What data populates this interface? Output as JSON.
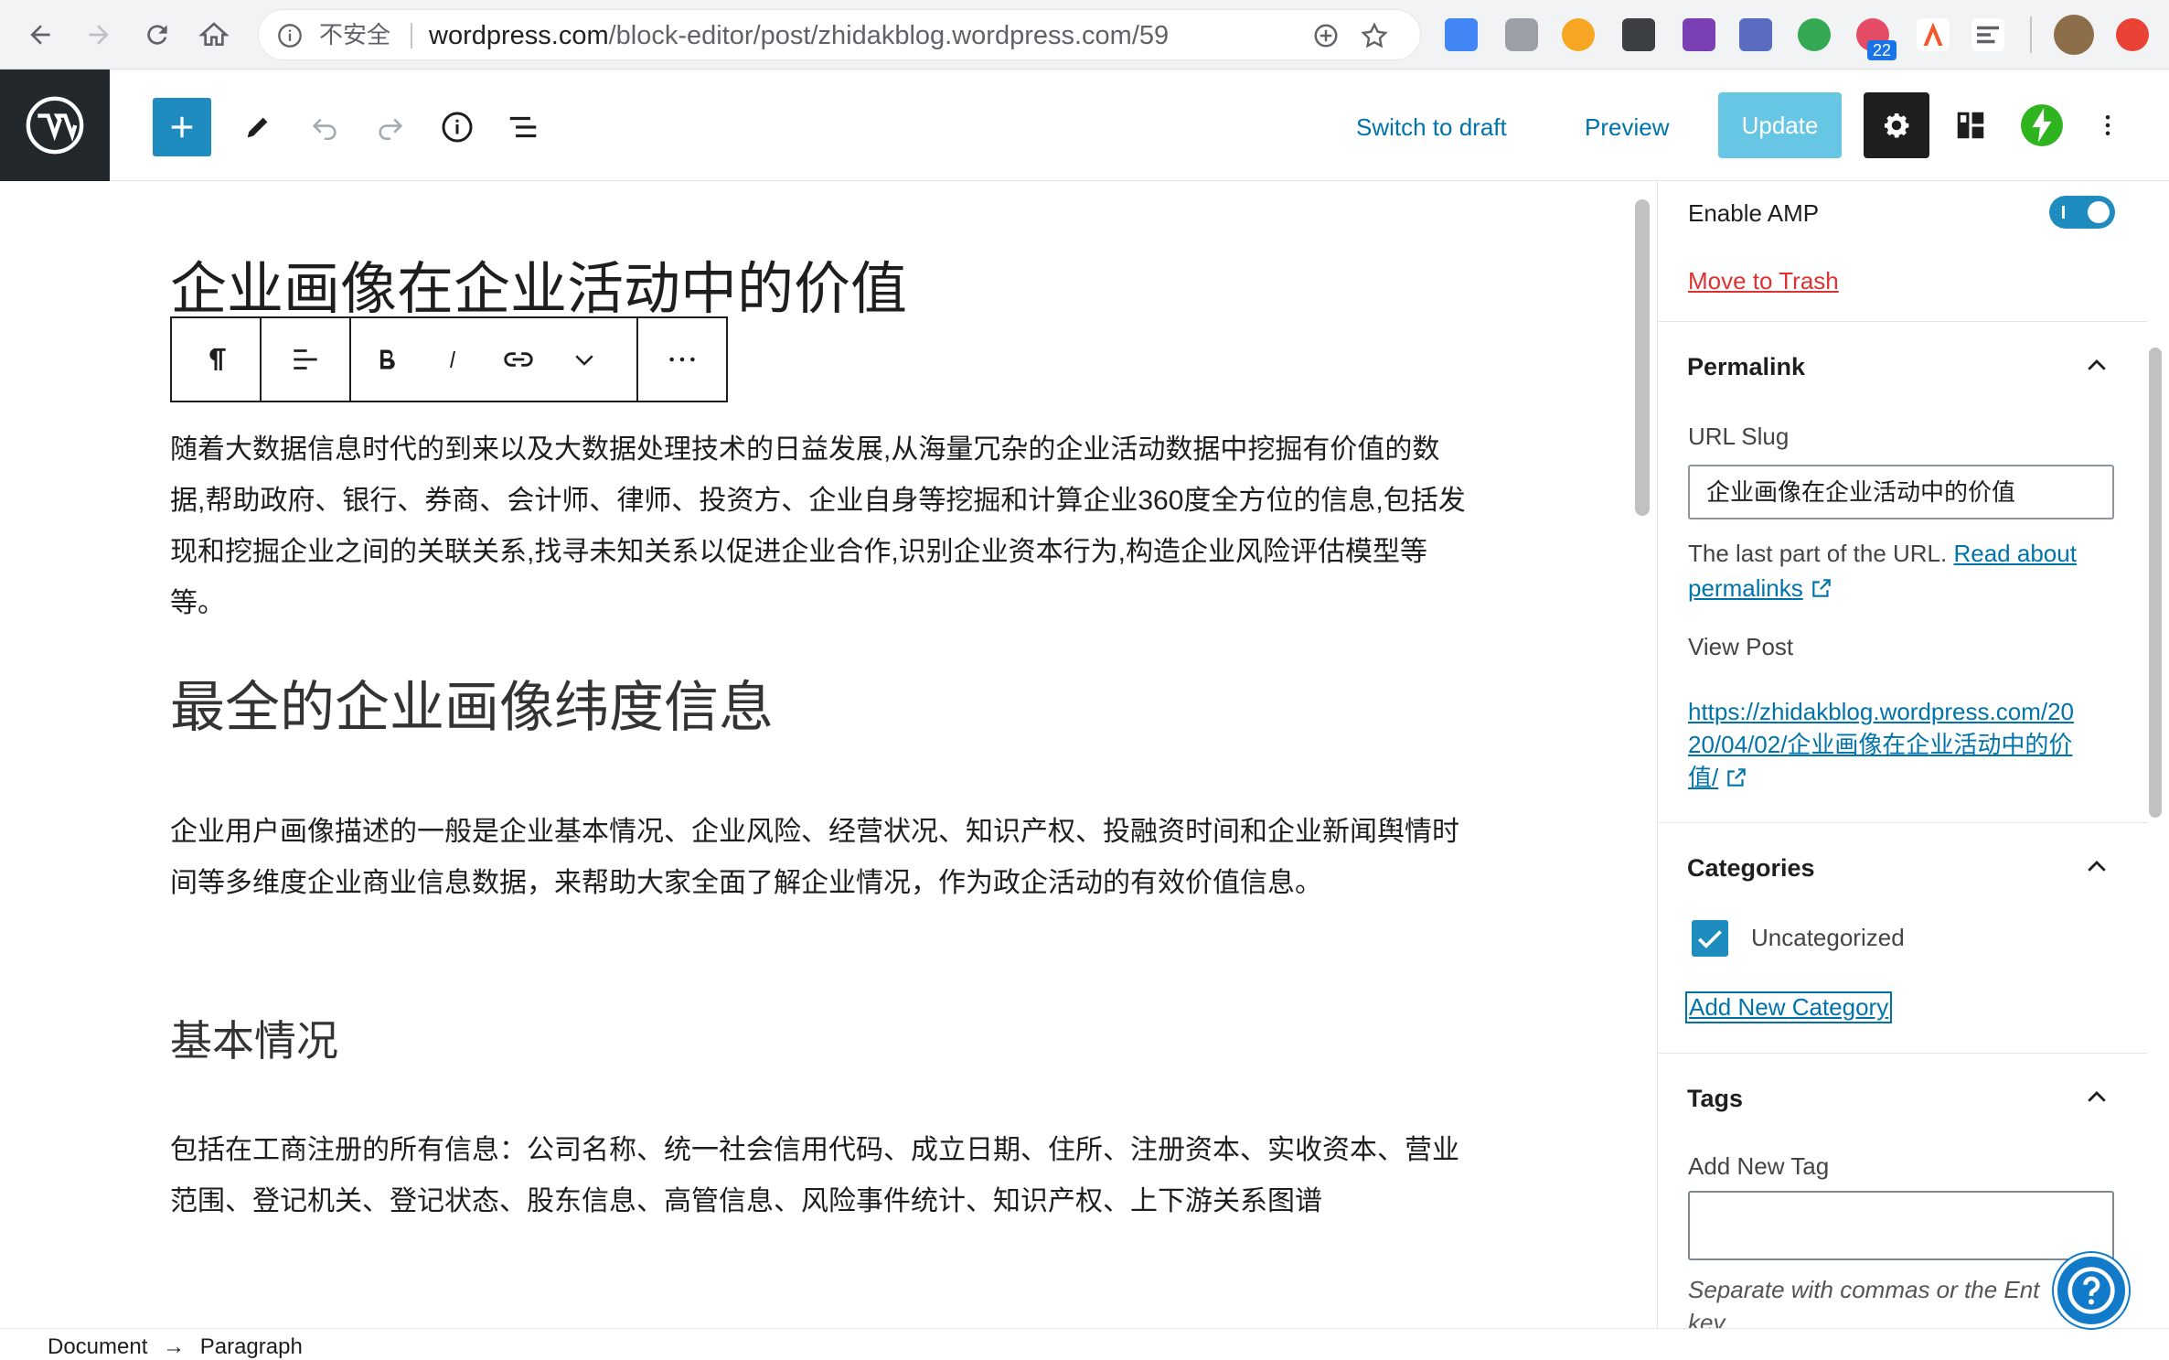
{
  "browser": {
    "insecure_label": "不安全",
    "url_host": "wordpress.com",
    "url_path": "/block-editor/post/zhidakblog.wordpress.com/59",
    "extension_badge": "22"
  },
  "header": {
    "switch_to_draft": "Switch to draft",
    "preview": "Preview",
    "update": "Update"
  },
  "post": {
    "title": "企业画像在企业活动中的价值",
    "p1": "随着大数据信息时代的到来以及大数据处理技术的日益发展,从海量冗杂的企业活动数据中挖掘有价值的数据,帮助政府、银行、券商、会计师、律师、投资方、企业自身等挖掘和计算企业360度全方位的信息,包括发现和挖掘企业之间的关联关系,找寻未知关系以促进企业合作,识别企业资本行为,构造企业风险评估模型等等。",
    "h2": "最全的企业画像纬度信息",
    "p2": "企业用户画像描述的一般是企业基本情况、企业风险、经营状况、知识产权、投融资时间和企业新闻舆情时间等多维度企业商业信息数据，来帮助大家全面了解企业情况，作为政企活动的有效价值信息。",
    "h3": "基本情况",
    "p3": "包括在工商注册的所有信息：公司名称、统一社会信用代码、成立日期、住所、注册资本、实收资本、营业范围、登记机关、登记状态、股东信息、高管信息、风险事件统计、知识产权、上下游关系图谱"
  },
  "sidebar": {
    "enable_amp": "Enable AMP",
    "amp_enabled": true,
    "move_to_trash": "Move to Trash",
    "permalink": {
      "heading": "Permalink",
      "url_slug_label": "URL Slug",
      "url_slug_value": "企业画像在企业活动中的价值",
      "help_text": "The last part of the URL.",
      "read_about": "Read about",
      "permalinks": "permalinks",
      "view_post_label": "View Post",
      "view_post_line1": "https://zhidakblog.wordpress.com/20",
      "view_post_line2": "20/04/02/企业画像在企业活动中的价",
      "view_post_line3": "值/"
    },
    "categories": {
      "heading": "Categories",
      "item": "Uncategorized",
      "checked": true,
      "add_new": "Add New Category"
    },
    "tags": {
      "heading": "Tags",
      "add_new_label": "Add New Tag",
      "help_line1": "Separate with commas or the Ent",
      "help_line2": "key."
    }
  },
  "footer": {
    "crumb1": "Document",
    "arrow": "→",
    "crumb2": "Paragraph"
  },
  "colors": {
    "wp_blue": "#0073aa",
    "primary_button": "#1e8cbe",
    "update_disabled": "#66c6e4",
    "dark": "#1e1e1e",
    "trash_red": "#dc3232",
    "jetpack_green": "#2fb41f"
  }
}
